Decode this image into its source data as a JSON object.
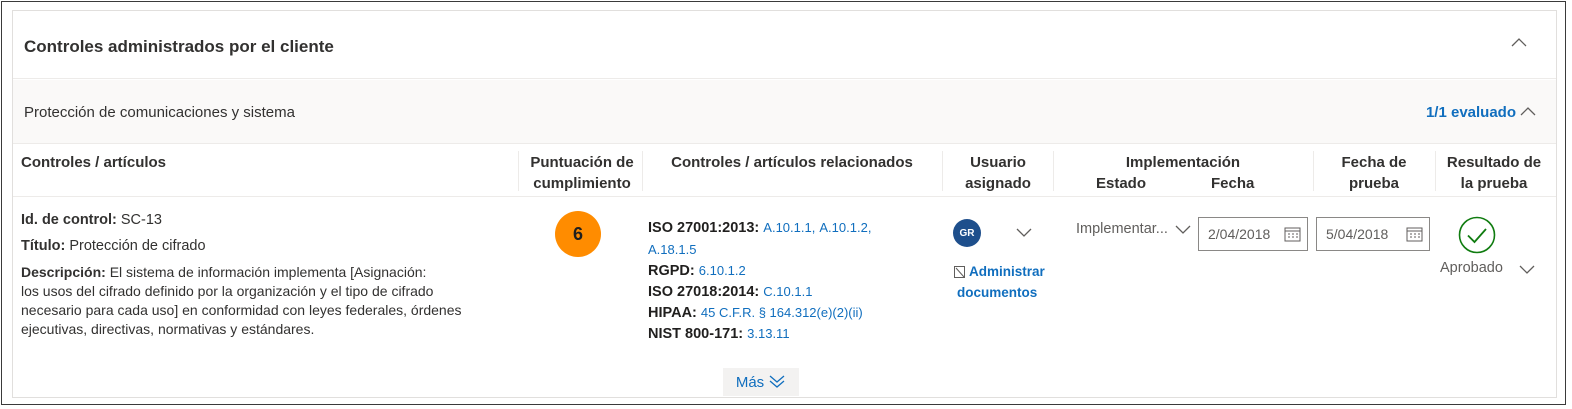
{
  "panel": {
    "title": "Controles administrados por el cliente"
  },
  "section": {
    "title": "Protección de comunicaciones y sistema",
    "evaluated": "1/1 evaluado"
  },
  "columns": {
    "controls": "Controles / artículos",
    "score_1": "Puntuación de",
    "score_2": "cumplimiento",
    "related": "Controles / artículos relacionados",
    "user_1": "Usuario",
    "user_2": "asignado",
    "impl": "Implementación",
    "impl_state": "Estado",
    "impl_date": "Fecha",
    "test_date_1": "Fecha de",
    "test_date_2": "prueba",
    "test_result_1": "Resultado de",
    "test_result_2": "la prueba"
  },
  "control": {
    "id_label": "Id. de control:",
    "id_value": "SC-13",
    "title_label": "Título:",
    "title_value": "Protección de cifrado",
    "desc_label": "Descripción:",
    "desc_l1": "El sistema de información implementa [Asignación:",
    "desc_l2": "los usos del cifrado definido por la organización y el tipo de cifrado",
    "desc_l3": "necesario para cada uso] en conformidad con leyes federales, órdenes",
    "desc_l4": "ejecutivas, directivas, normativas y estándares.",
    "score": "6",
    "related": {
      "iso27001_label": "ISO 27001:2013:",
      "iso27001_a": "A.10.1.1",
      "iso27001_b": "A.10.1.2",
      "iso27001_c": "A.18.1.5",
      "sep": ",",
      "rgpd_label": "RGPD:",
      "rgpd_value": "6.10.1.2",
      "iso27018_label": "ISO 27018:2014:",
      "iso27018_value": "C.10.1.1",
      "hipaa_label": "HIPAA:",
      "hipaa_value": "45 C.F.R.  § 164.312(e)(2)(ii)",
      "nist_label": "NIST 800-171:",
      "nist_value": "3.13.11"
    },
    "user_initials": "GR",
    "manage_1": "Administrar",
    "manage_2": "documentos",
    "impl_state": "Implementar...",
    "impl_date": "2/04/2018",
    "test_date": "5/04/2018",
    "test_result": "Aprobado"
  },
  "more_label": "Más",
  "colors": {
    "accent": "#106ebe",
    "score": "#ff8c00",
    "pass": "#107c10",
    "avatar": "#1e4f8c"
  }
}
